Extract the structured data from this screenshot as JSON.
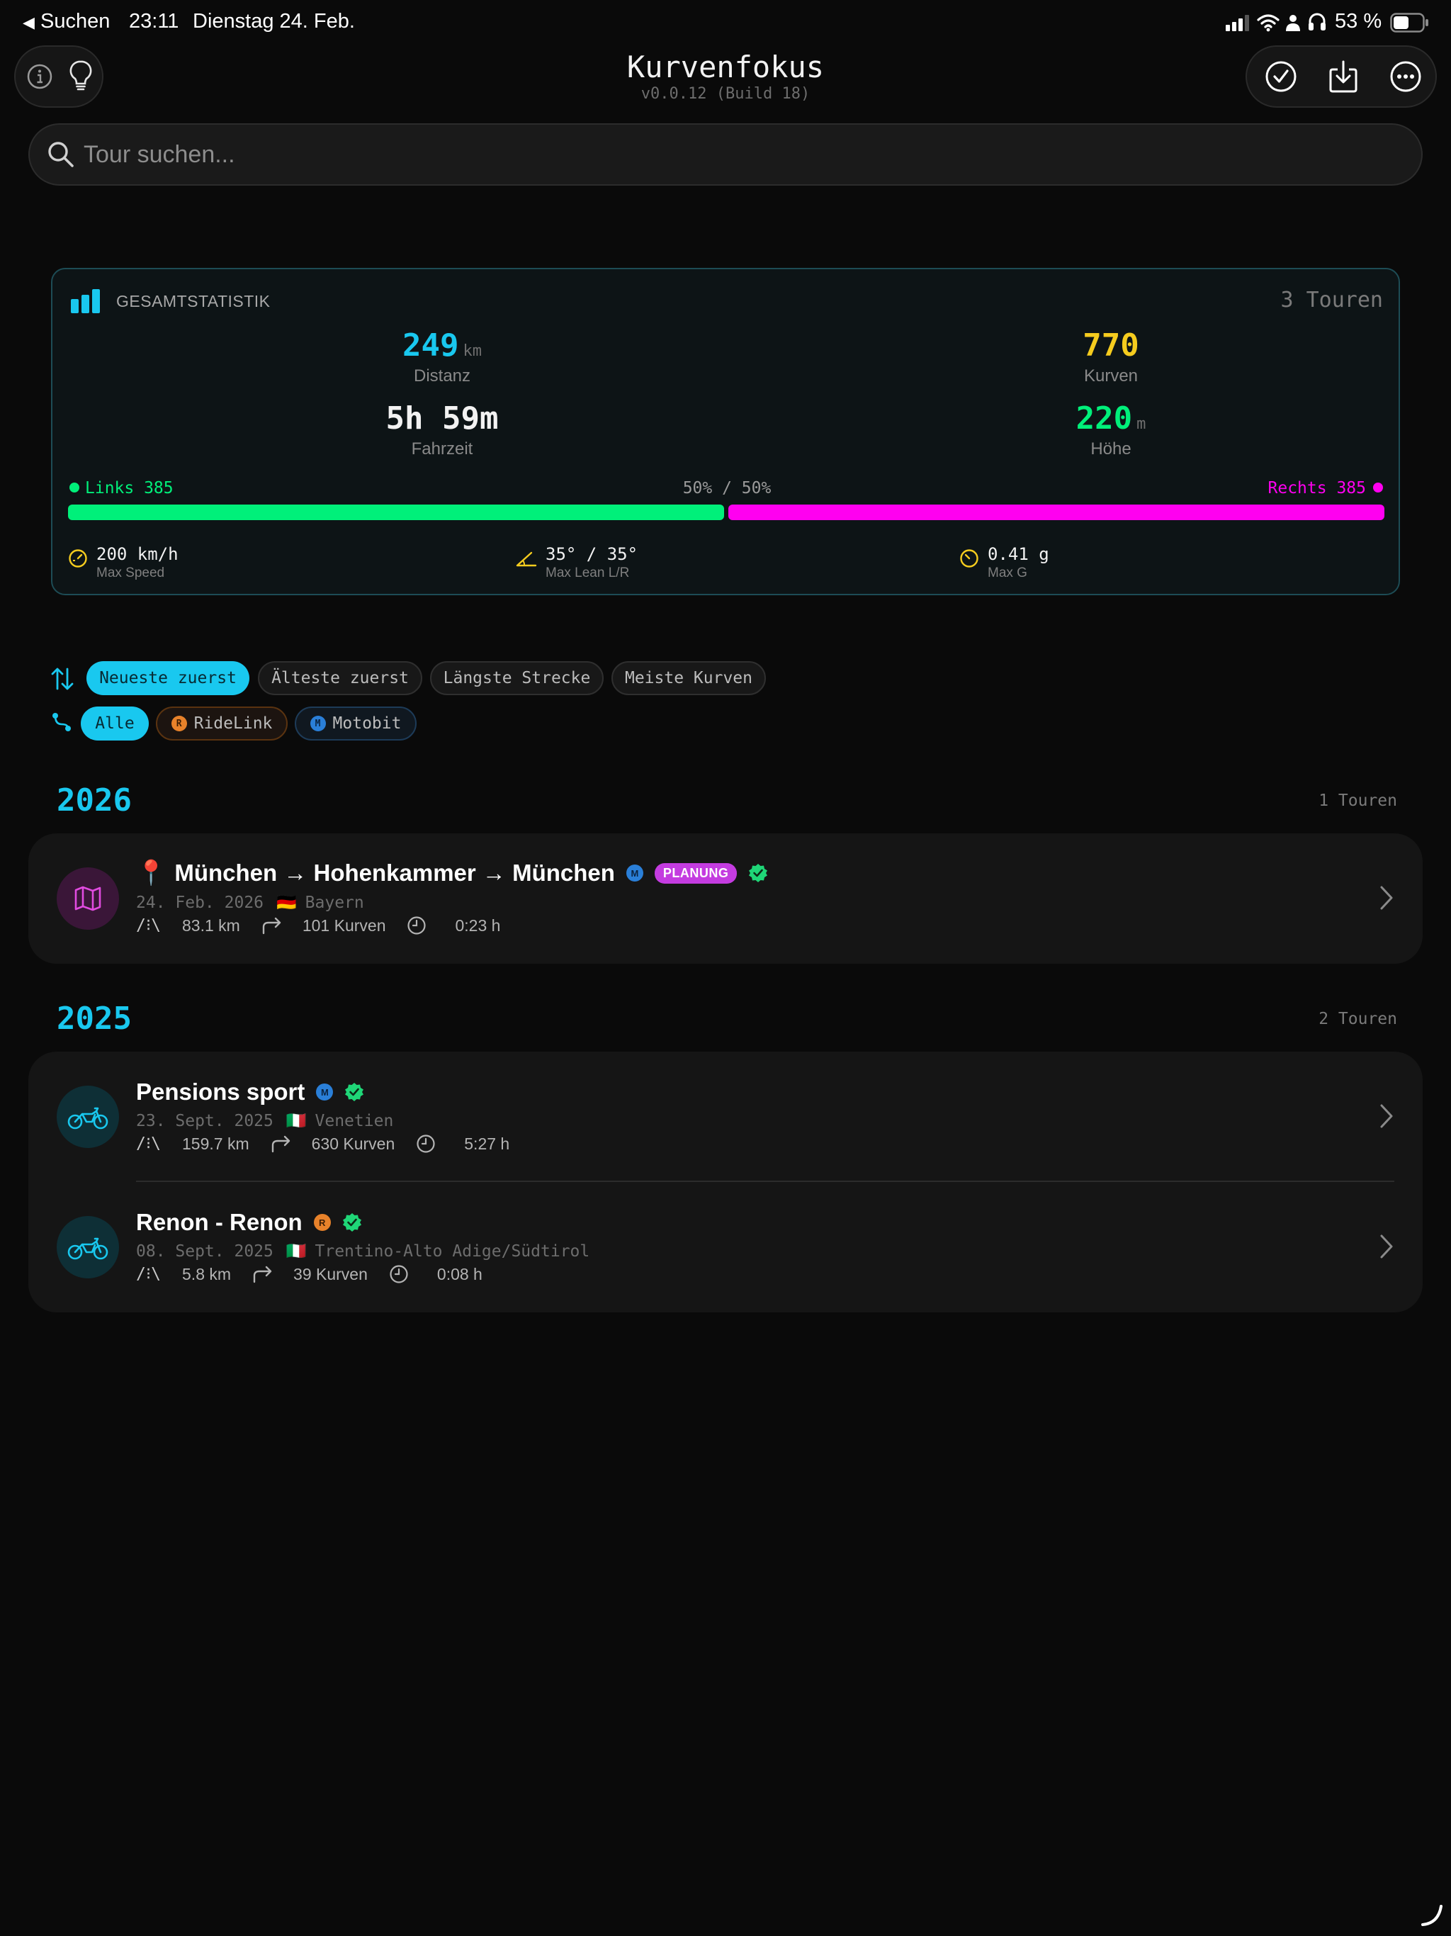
{
  "status_bar": {
    "back_label": "Suchen",
    "time": "23:11",
    "date": "Dienstag 24. Feb.",
    "battery": "53 %"
  },
  "header": {
    "title": "Kurvenfokus",
    "version": "v0.0.12 (Build 18)"
  },
  "search": {
    "placeholder": "Tour suchen..."
  },
  "stats": {
    "title": "GESAMTSTATISTIK",
    "tour_count": "3 Touren",
    "distance": {
      "value": "249",
      "unit": "km",
      "label": "Distanz"
    },
    "curves": {
      "value": "770",
      "label": "Kurven"
    },
    "ride_time": {
      "value": "5h 59m",
      "label": "Fahrzeit"
    },
    "elevation": {
      "value": "220",
      "unit": "m",
      "label": "Höhe"
    },
    "left_label": "Links 385",
    "right_label": "Rechts 385",
    "split_label": "50% / 50%",
    "left_fraction": 0.5,
    "max_speed": {
      "value": "200 km/h",
      "label": "Max Speed"
    },
    "max_lean": {
      "value": "35° / 35°",
      "label": "Max Lean L/R"
    },
    "max_g": {
      "value": "0.41 g",
      "label": "Max G"
    }
  },
  "sort_chips": [
    "Neueste zuerst",
    "Älteste zuerst",
    "Längste Strecke",
    "Meiste Kurven"
  ],
  "source_chips": {
    "all": "Alle",
    "ridelink": "RideLink",
    "ridelink_letter": "R",
    "motobit": "Motobit",
    "motobit_letter": "M"
  },
  "years": [
    {
      "year": "2026",
      "count": "1 Touren",
      "tours": [
        {
          "title": "München → Hohenkammer → München",
          "source_letter": "M",
          "badge": "PLANUNG",
          "date": "24. Feb. 2026",
          "flag": "🇩🇪",
          "region": "Bayern",
          "distance": "83.1 km",
          "curves": "101 Kurven",
          "duration": "0:23 h"
        }
      ]
    },
    {
      "year": "2025",
      "count": "2 Touren",
      "tours": [
        {
          "title": "Pensions sport",
          "source_letter": "M",
          "date": "23. Sept. 2025",
          "flag": "🇮🇹",
          "region": "Venetien",
          "distance": "159.7 km",
          "curves": "630 Kurven",
          "duration": "5:27 h"
        },
        {
          "title": "Renon - Renon",
          "source_letter": "R",
          "date": "08. Sept. 2025",
          "flag": "🇮🇹",
          "region": "Trentino-Alto Adige/Südtirol",
          "distance": "5.8 km",
          "curves": "39 Kurven",
          "duration": "0:08 h"
        }
      ]
    }
  ],
  "colors": {
    "accent": "#19c8ef",
    "curves": "#f5cc1e",
    "left": "#00f07a",
    "right": "#ff00f0",
    "planung": "#c43ce0",
    "ridelink": "#e8822a",
    "motobit": "#2a7fd8"
  }
}
